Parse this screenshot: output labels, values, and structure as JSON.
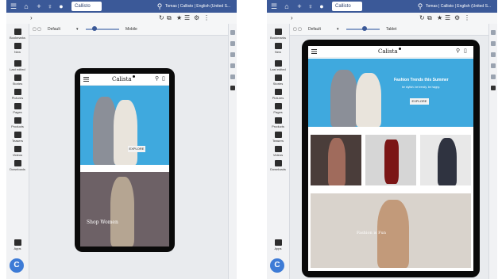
{
  "editor": {
    "tab_label": "Callisto",
    "user_label": "Tomas | Callisto | English (United S...",
    "toolbar_preset": "Default",
    "left_device": "Mobile",
    "right_device": "Tablet"
  },
  "sidebar": {
    "items": [
      {
        "label": "Bookmarks"
      },
      {
        "label": "New"
      },
      {
        "label": "Last edited"
      },
      {
        "label": "Stories"
      },
      {
        "label": "Pictures"
      },
      {
        "label": "Pages"
      },
      {
        "label": "Products"
      },
      {
        "label": "Teasers"
      },
      {
        "label": "Videos"
      },
      {
        "label": "Downloads"
      }
    ],
    "bottom_label": "Apps"
  },
  "site": {
    "logo": "Calista",
    "hero_title": "Fashion Trends this Summer",
    "hero_sub": "be stylish. be trendy. be happy.",
    "hero_button": "EXPLORE",
    "tile_women": "Shop Women",
    "tile_fashion": "Fashion is Fun"
  },
  "colors": {
    "topbar": "#3b5998",
    "hero_bg": "#3fa9de",
    "device": "#0a0a0a",
    "app_button": "#3d7bd6"
  },
  "icons": [
    "menu-icon",
    "home-icon",
    "plus-icon",
    "bulb-icon",
    "chat-icon",
    "search-icon",
    "cart-icon",
    "gear-icon",
    "star-icon"
  ]
}
